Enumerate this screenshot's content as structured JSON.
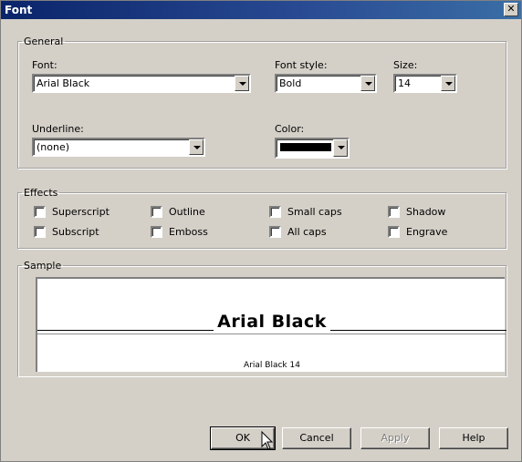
{
  "window": {
    "title": "Font",
    "close_glyph": "✕"
  },
  "general": {
    "legend": "General",
    "font_label": "Font:",
    "font_value": "Arial Black",
    "style_label": "Font style:",
    "style_value": "Bold",
    "size_label": "Size:",
    "size_value": "14",
    "underline_label": "Underline:",
    "underline_value": "(none)",
    "color_label": "Color:",
    "color_value": "#000000"
  },
  "effects": {
    "legend": "Effects",
    "items": [
      {
        "label": "Superscript",
        "checked": false
      },
      {
        "label": "Outline",
        "checked": false
      },
      {
        "label": "Small caps",
        "checked": false
      },
      {
        "label": "Shadow",
        "checked": false
      },
      {
        "label": "Subscript",
        "checked": false
      },
      {
        "label": "Emboss",
        "checked": false
      },
      {
        "label": "All caps",
        "checked": false
      },
      {
        "label": "Engrave",
        "checked": false
      }
    ]
  },
  "sample": {
    "legend": "Sample",
    "preview_text": "Arial Black",
    "caption": "Arial Black 14"
  },
  "buttons": {
    "ok": "OK",
    "cancel": "Cancel",
    "apply": "Apply",
    "help": "Help"
  }
}
